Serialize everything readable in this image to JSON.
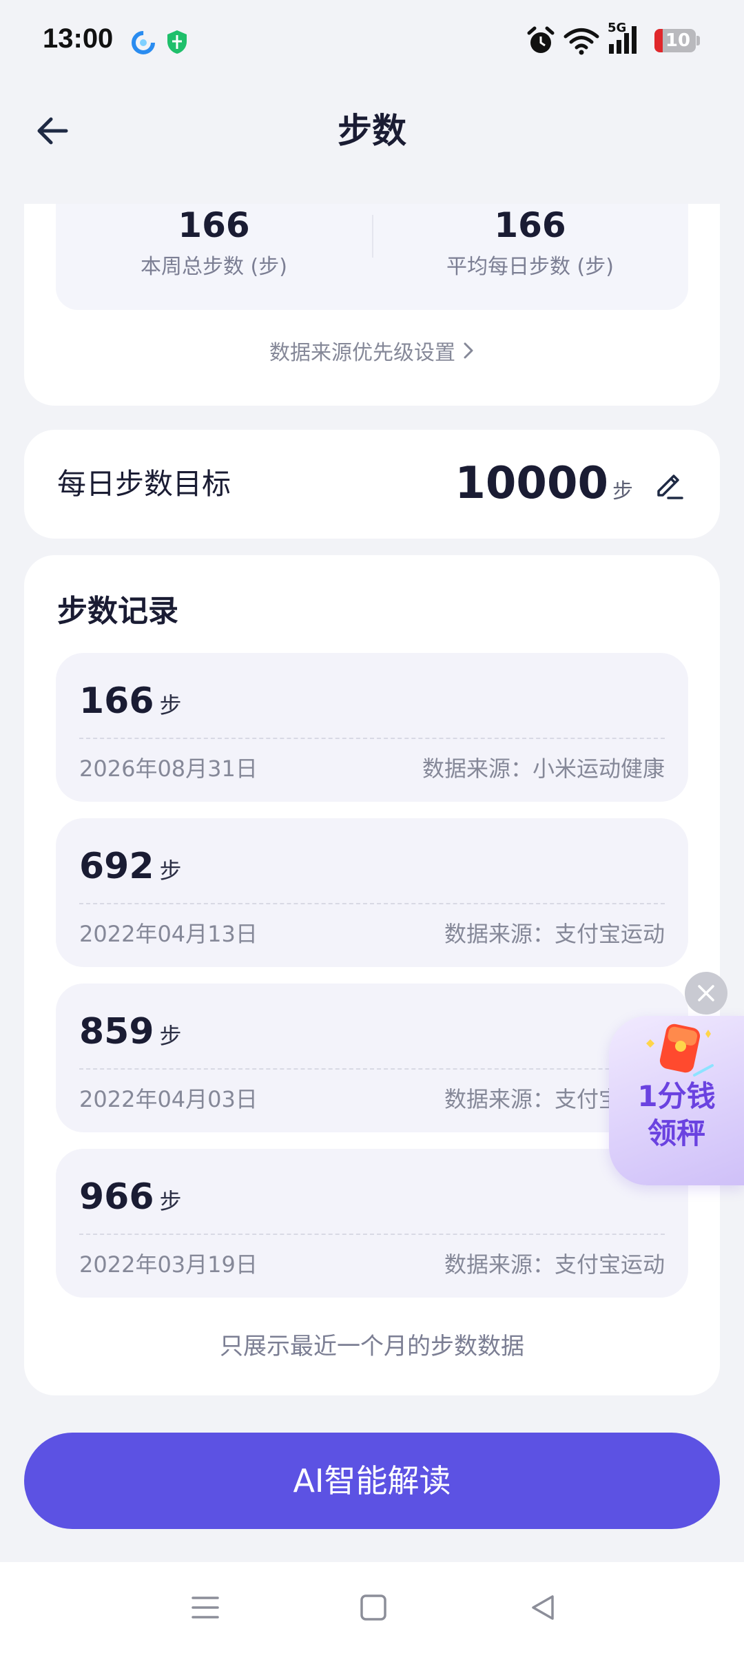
{
  "status_bar": {
    "time": "13:00",
    "network": "5G",
    "battery": "10",
    "icons": [
      "app-notification-icon",
      "shield-icon",
      "alarm-icon",
      "wifi-icon",
      "signal-icon",
      "battery-icon"
    ]
  },
  "header": {
    "title": "步数",
    "back_icon": "back-arrow-icon"
  },
  "weekly_stats": {
    "total": {
      "value": "166",
      "label": "本周总步数 (步)"
    },
    "average": {
      "value": "166",
      "label": "平均每日步数 (步)"
    },
    "source_priority_link": "数据来源优先级设置"
  },
  "goal": {
    "label": "每日步数目标",
    "value": "10000",
    "unit": "步",
    "edit_icon": "edit-pencil-icon"
  },
  "records": {
    "title": "步数记录",
    "items": [
      {
        "steps": "166",
        "unit": "步",
        "date": "2026年08月31日",
        "source": "数据来源：小米运动健康"
      },
      {
        "steps": "692",
        "unit": "步",
        "date": "2022年04月13日",
        "source": "数据来源：支付宝运动"
      },
      {
        "steps": "859",
        "unit": "步",
        "date": "2022年04月03日",
        "source": "数据来源：支付宝运动"
      },
      {
        "steps": "966",
        "unit": "步",
        "date": "2022年03月19日",
        "source": "数据来源：支付宝运动"
      }
    ],
    "note": "只展示最近一个月的步数数据"
  },
  "ai_button": {
    "label": "AI智能解读"
  },
  "promo": {
    "line1": "1分钱",
    "line2": "领秤",
    "close_icon": "close-icon",
    "gift_icon": "red-envelope-icon"
  },
  "nav_bar": {
    "icons": [
      "menu-icon",
      "home-square-icon",
      "back-triangle-icon"
    ]
  },
  "colors": {
    "accent": "#5c52e3",
    "background": "#f2f3f7",
    "card": "#ffffff",
    "record_bg": "#f3f3fa",
    "promo_text": "#6a42e0"
  }
}
